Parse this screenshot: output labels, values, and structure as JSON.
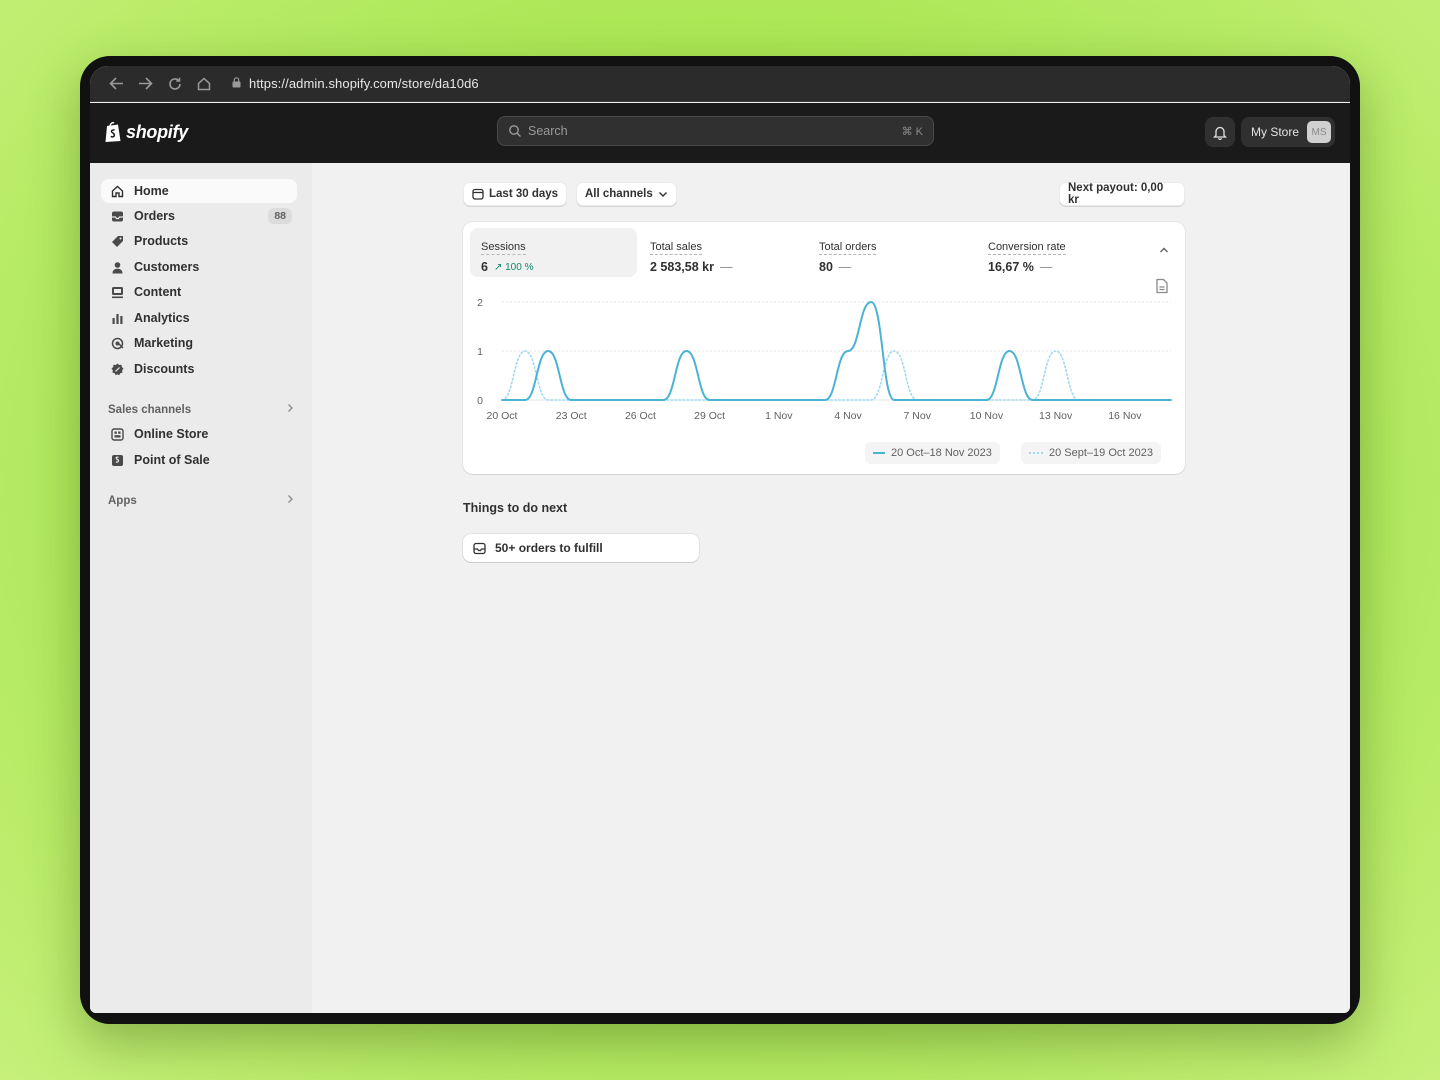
{
  "browser": {
    "url": "https://admin.shopify.com/store/da10d6",
    "back_icon": "arrow-left-icon",
    "forward_icon": "arrow-right-icon",
    "reload_icon": "reload-icon",
    "home_icon": "home-icon"
  },
  "topbar": {
    "logo_text": "shopify",
    "search_placeholder": "Search",
    "search_shortcut": "⌘ K",
    "store_name": "My Store",
    "store_initials": "MS"
  },
  "sidebar": {
    "items": [
      {
        "label": "Home",
        "icon": "home-icon",
        "active": true
      },
      {
        "label": "Orders",
        "icon": "inbox-icon",
        "badge": "88"
      },
      {
        "label": "Products",
        "icon": "tag-icon"
      },
      {
        "label": "Customers",
        "icon": "person-icon"
      },
      {
        "label": "Content",
        "icon": "content-icon"
      },
      {
        "label": "Analytics",
        "icon": "bar-chart-icon"
      },
      {
        "label": "Marketing",
        "icon": "target-icon"
      },
      {
        "label": "Discounts",
        "icon": "discount-icon"
      }
    ],
    "sales_channels_label": "Sales channels",
    "channels": [
      {
        "label": "Online Store",
        "icon": "store-icon"
      },
      {
        "label": "Point of Sale",
        "icon": "pos-icon"
      }
    ],
    "apps_label": "Apps"
  },
  "filters": {
    "date_range": "Last 30 days",
    "channels": "All channels",
    "payout": "Next payout: 0,00 kr"
  },
  "metrics": [
    {
      "label": "Sessions",
      "value": "6",
      "trend": "↗ 100 %"
    },
    {
      "label": "Total sales",
      "value": "2 583,58 kr",
      "trend": "—"
    },
    {
      "label": "Total orders",
      "value": "80",
      "trend": "—"
    },
    {
      "label": "Conversion rate",
      "value": "16,67 %",
      "trend": "—"
    }
  ],
  "chart_data": {
    "type": "line",
    "x": [
      "20 Oct",
      "21 Oct",
      "22 Oct",
      "23 Oct",
      "24 Oct",
      "25 Oct",
      "26 Oct",
      "27 Oct",
      "28 Oct",
      "29 Oct",
      "30 Oct",
      "31 Oct",
      "1 Nov",
      "2 Nov",
      "3 Nov",
      "4 Nov",
      "5 Nov",
      "6 Nov",
      "7 Nov",
      "8 Nov",
      "9 Nov",
      "10 Nov",
      "11 Nov",
      "12 Nov",
      "13 Nov",
      "14 Nov",
      "15 Nov",
      "16 Nov",
      "17 Nov",
      "18 Nov"
    ],
    "tick_labels": [
      "20 Oct",
      "23 Oct",
      "26 Oct",
      "29 Oct",
      "1 Nov",
      "4 Nov",
      "7 Nov",
      "10 Nov",
      "13 Nov",
      "16 Nov"
    ],
    "series": [
      {
        "name": "20 Oct–18 Nov 2023",
        "style": "solid",
        "color": "#4db3d4",
        "values": [
          0,
          0,
          1,
          0,
          0,
          0,
          0,
          0,
          1,
          0,
          0,
          0,
          0,
          0,
          0,
          1,
          2,
          0,
          0,
          0,
          0,
          0,
          1,
          0,
          0,
          0,
          0,
          0,
          0,
          0
        ]
      },
      {
        "name": "20 Sept–19 Oct 2023",
        "style": "dotted",
        "color": "#9fdaec",
        "values": [
          0,
          1,
          0,
          0,
          0,
          0,
          0,
          0,
          0,
          0,
          0,
          0,
          0,
          0,
          0,
          0,
          0,
          1,
          0,
          0,
          0,
          0,
          0,
          0,
          1,
          0,
          0,
          0,
          0,
          0
        ]
      }
    ],
    "ylim": [
      0,
      2
    ],
    "yticks": [
      0,
      1,
      2
    ],
    "grid": true,
    "legend": "bottom-right"
  },
  "things": {
    "title": "Things to do next",
    "items": [
      {
        "label": "50+ orders to fulfill",
        "icon": "inbox-icon"
      }
    ]
  }
}
